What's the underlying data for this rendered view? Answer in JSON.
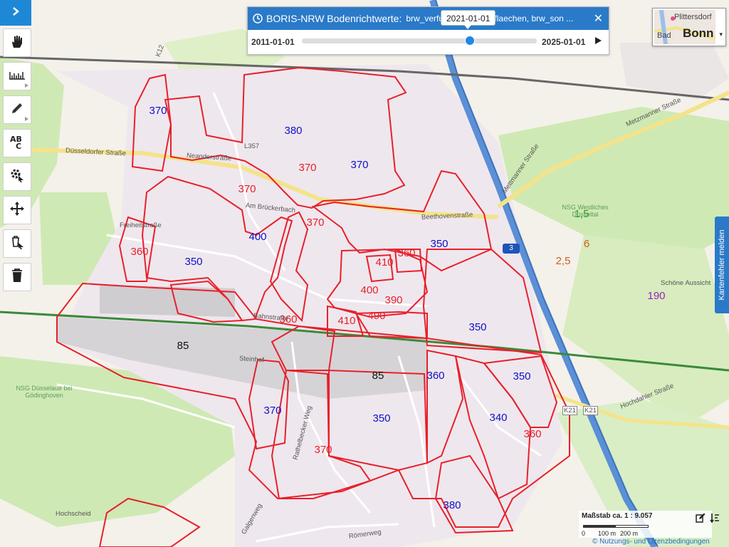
{
  "layer_panel": {
    "title": "BORIS-NRW Bodenrichtwerte:",
    "subtitle": "brw_verfue... sonstige_flaechen, brw_son ...",
    "close_label": "✕",
    "date_bubble": "2021-01-01",
    "start_date": "2011-01-01",
    "end_date": "2025-01-01",
    "time_position": 0.714
  },
  "basemap": {
    "label_top": "Plittersdorf",
    "label_left": "Bad",
    "label_city": "Bonn",
    "caret": "▾"
  },
  "report_tab": {
    "label": "Kartenfehler melden"
  },
  "scale": {
    "title": "Maßstab ca. 1 : 9.057",
    "ticks": [
      "0",
      "100 m",
      "200 m"
    ]
  },
  "terms": "© Nutzungs- und Lizenzbedingungen",
  "toolbar": {
    "toggle": "chevron-right-icon",
    "tools": [
      "pan-hand-icon",
      "measure-ruler-icon",
      "draw-pencil-icon",
      "spellcheck-abc-icon",
      "settings-cursor-icon",
      "move-feature-icon",
      "delete-select-icon",
      "trash-icon"
    ]
  },
  "colors": {
    "zone_border": "#e8202a",
    "panel": "#2a7ac9",
    "highway": "#5b8fd6",
    "green_area": "#cfe9b4"
  },
  "map": {
    "zone_values": [
      {
        "text": "370",
        "color": "#1010c8"
      },
      {
        "text": "380",
        "color": "#1010c8"
      },
      {
        "text": "370",
        "color": "#e8202a"
      },
      {
        "text": "370",
        "color": "#1010c8"
      },
      {
        "text": "370",
        "color": "#e8202a"
      },
      {
        "text": "370",
        "color": "#e8202a"
      },
      {
        "text": "400",
        "color": "#1010c8"
      },
      {
        "text": "360",
        "color": "#e8202a"
      },
      {
        "text": "350",
        "color": "#1010c8"
      },
      {
        "text": "350",
        "color": "#1010c8"
      },
      {
        "text": "360",
        "color": "#e8202a"
      },
      {
        "text": "410",
        "color": "#e8202a"
      },
      {
        "text": "400",
        "color": "#e8202a"
      },
      {
        "text": "390",
        "color": "#e8202a"
      },
      {
        "text": "490",
        "color": "#e8202a"
      },
      {
        "text": "410",
        "color": "#e8202a"
      },
      {
        "text": "360",
        "color": "#e8202a"
      },
      {
        "text": "350",
        "color": "#1010c8"
      },
      {
        "text": "85",
        "color": "#111111"
      },
      {
        "text": "85",
        "color": "#111111"
      },
      {
        "text": "360",
        "color": "#1010c8"
      },
      {
        "text": "350",
        "color": "#1010c8"
      },
      {
        "text": "370",
        "color": "#1010c8"
      },
      {
        "text": "350",
        "color": "#1010c8"
      },
      {
        "text": "340",
        "color": "#1010c8"
      },
      {
        "text": "370",
        "color": "#e8202a"
      },
      {
        "text": "360",
        "color": "#e8202a"
      },
      {
        "text": "380",
        "color": "#1010c8"
      },
      {
        "text": "1,5",
        "color": "#2c9a2c"
      },
      {
        "text": "6",
        "color": "#c8601a"
      },
      {
        "text": "2,5",
        "color": "#c8601a"
      },
      {
        "text": "190",
        "color": "#9a22b8"
      }
    ],
    "streets": [
      "Düsseldorfer Straße",
      "Neanderstraße",
      "Beethovenstraße",
      "Mettmanner Straße",
      "Metzmanner Straße",
      "Am Brückerbach",
      "Hochdahler Straße",
      "Freiheitstraße",
      "Schöne Aussicht",
      "Römerweg",
      "Hochscheid",
      "Galgenweg",
      "Rathelbecker Weg",
      "Bahnstraße",
      "Steinhof"
    ],
    "places": [
      "NSG Westliches Düsseltal",
      "NSG Düsselaue bei Gödinghoven"
    ],
    "road_refs": [
      "K12",
      "L357",
      "3",
      "K21",
      "K21"
    ]
  }
}
